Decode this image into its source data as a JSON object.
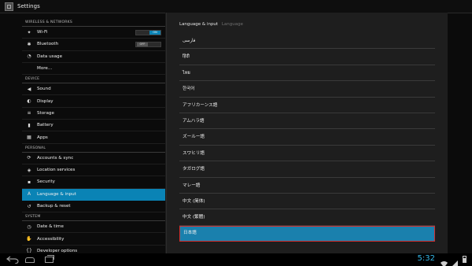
{
  "app": {
    "title": "Settings",
    "icon": "settings-app-icon"
  },
  "sidebar": {
    "sections": [
      {
        "header": "WIRELESS & NETWORKS",
        "items": [
          {
            "label": "Wi-Fi",
            "icon": "wifi-icon",
            "toggle": "ON"
          },
          {
            "label": "Bluetooth",
            "icon": "bluetooth-icon",
            "toggle": "OFF"
          },
          {
            "label": "Data usage",
            "icon": "data-usage-icon"
          },
          {
            "label": "More…",
            "icon": ""
          }
        ]
      },
      {
        "header": "DEVICE",
        "items": [
          {
            "label": "Sound",
            "icon": "sound-icon"
          },
          {
            "label": "Display",
            "icon": "display-icon"
          },
          {
            "label": "Storage",
            "icon": "storage-icon"
          },
          {
            "label": "Battery",
            "icon": "battery-icon"
          },
          {
            "label": "Apps",
            "icon": "apps-icon"
          }
        ]
      },
      {
        "header": "PERSONAL",
        "items": [
          {
            "label": "Accounts & sync",
            "icon": "sync-icon"
          },
          {
            "label": "Location services",
            "icon": "location-icon"
          },
          {
            "label": "Security",
            "icon": "lock-icon"
          },
          {
            "label": "Language & input",
            "icon": "language-icon",
            "selected": true
          },
          {
            "label": "Backup & reset",
            "icon": "backup-icon"
          }
        ]
      },
      {
        "header": "SYSTEM",
        "items": [
          {
            "label": "Date & time",
            "icon": "clock-icon"
          },
          {
            "label": "Accessibility",
            "icon": "accessibility-icon"
          },
          {
            "label": "Developer options",
            "icon": "developer-icon"
          }
        ]
      }
    ]
  },
  "dialog": {
    "title": "Language & input",
    "subtitle": "Language",
    "languages": [
      "فارسی",
      "हिंदी",
      "ไทย",
      "한국어",
      "アフリカーンス語",
      "アムハラ語",
      "ズールー語",
      "スワヒリ語",
      "タガログ語",
      "マレー語",
      "中文 (简体)",
      "中文 (繁體)",
      "日本語"
    ],
    "selected_index": 12
  },
  "navbar": {
    "clock": "5:32",
    "back_icon": "back-icon",
    "home_icon": "home-icon",
    "recent_icon": "recent-apps-icon"
  },
  "colors": {
    "accent": "#0a83b5",
    "highlight_border": "#d12e2e",
    "clock": "#33b5e5"
  }
}
